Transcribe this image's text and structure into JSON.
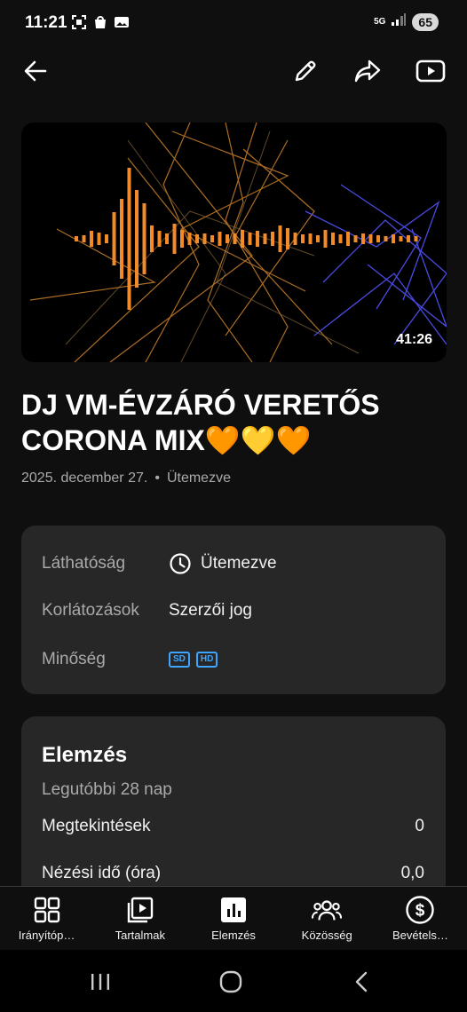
{
  "status": {
    "time": "11:21",
    "network": "5G",
    "battery": "65"
  },
  "toolbar": {
    "back_icon": "back-arrow-icon",
    "edit_icon": "pencil-icon",
    "share_icon": "share-icon",
    "youtube_icon": "youtube-icon"
  },
  "video": {
    "duration": "41:26",
    "title": "DJ VM-ÉVZÁRÓ VERETŐS CORONA MIX🧡💛🧡",
    "date": "2025. december 27.",
    "separator": "•",
    "status": "Ütemezve"
  },
  "info": {
    "visibility_label": "Láthatóság",
    "visibility_value": "Ütemezve",
    "restrictions_label": "Korlátozások",
    "restrictions_value": "Szerzői jog",
    "quality_label": "Minőség",
    "quality_badges": [
      "SD",
      "HD"
    ]
  },
  "analytics": {
    "title": "Elemzés",
    "period": "Legutóbbi 28 nap",
    "rows": [
      {
        "label": "Megtekintések",
        "value": "0"
      },
      {
        "label": "Nézési idő (óra)",
        "value": "0,0"
      }
    ]
  },
  "nav": {
    "items": [
      {
        "label": "Irányítóp…",
        "icon": "dashboard-icon"
      },
      {
        "label": "Tartalmak",
        "icon": "content-icon"
      },
      {
        "label": "Elemzés",
        "icon": "analytics-icon"
      },
      {
        "label": "Közösség",
        "icon": "community-icon"
      },
      {
        "label": "Bevétels…",
        "icon": "earn-icon"
      }
    ]
  },
  "colors": {
    "background": "#0f0f0f",
    "card": "#272727",
    "accent_blue": "#3ea6ff",
    "waveform_orange": "#f28a2a"
  }
}
